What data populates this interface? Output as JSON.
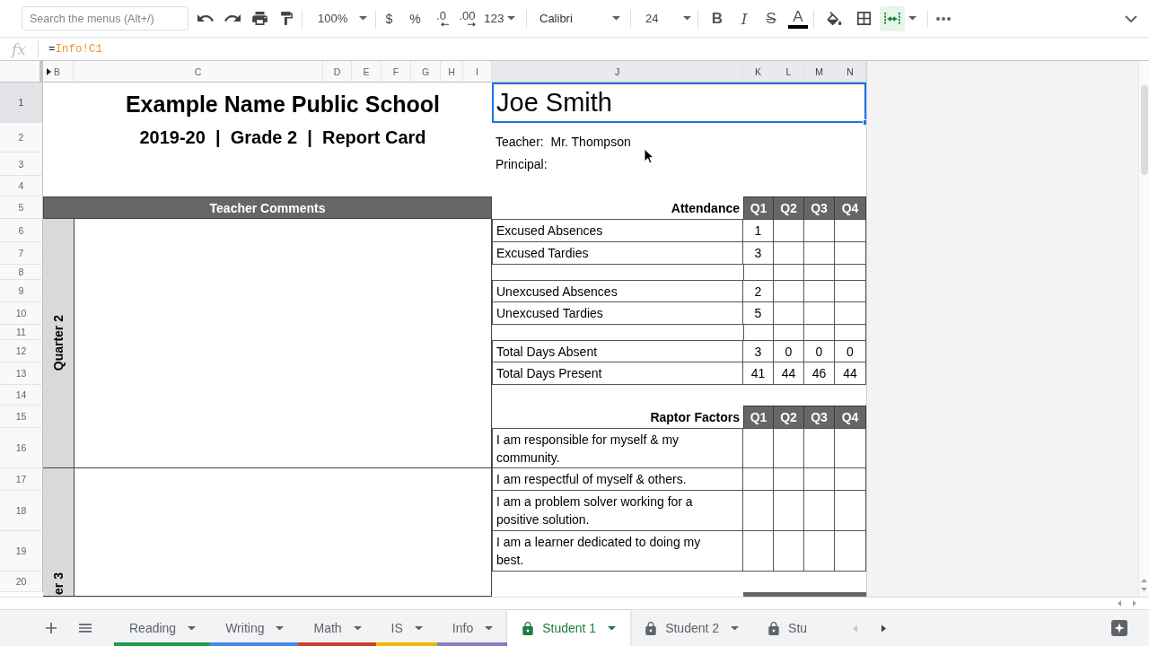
{
  "toolbar": {
    "search": {
      "placeholder": "Search the menus (Alt+/)"
    },
    "zoom": "100%",
    "format_buttons": [
      {
        "kind": "currency",
        "label": "$"
      },
      {
        "kind": "percent",
        "label": "%"
      },
      {
        "kind": "decrease_decimals",
        "label": ".0"
      },
      {
        "kind": "increase_decimals",
        "label": ".00"
      }
    ],
    "number_format": "123",
    "font": "Calibri",
    "font_size": "24",
    "style_buttons": [
      {
        "kind": "bold",
        "label": "B"
      },
      {
        "kind": "italic",
        "label": "I"
      },
      {
        "kind": "strikethrough",
        "label": "S"
      },
      {
        "kind": "text_color",
        "label": "A"
      }
    ],
    "merge_active": true
  },
  "formula_bar": {
    "fx": "fx",
    "prefix": "=",
    "reference": "Info!C1"
  },
  "columns": [
    {
      "label": "B",
      "selected": false,
      "hidden_left": true
    },
    {
      "label": "C",
      "selected": false,
      "hidden_left": false
    },
    {
      "label": "D",
      "selected": false,
      "hidden_left": false
    },
    {
      "label": "E",
      "selected": false,
      "hidden_left": false
    },
    {
      "label": "F",
      "selected": false,
      "hidden_left": false
    },
    {
      "label": "G",
      "selected": false,
      "hidden_left": false
    },
    {
      "label": "H",
      "selected": false,
      "hidden_left": false
    },
    {
      "label": "I",
      "selected": false,
      "hidden_left": false
    },
    {
      "label": "J",
      "selected": true,
      "hidden_left": false
    },
    {
      "label": "K",
      "selected": true,
      "hidden_left": false
    },
    {
      "label": "L",
      "selected": true,
      "hidden_left": false
    },
    {
      "label": "M",
      "selected": true,
      "hidden_left": false
    },
    {
      "label": "N",
      "selected": true,
      "hidden_left": false
    }
  ],
  "row_headers": [
    {
      "label": "1",
      "selected": true
    },
    {
      "label": "2",
      "selected": false
    },
    {
      "label": "3",
      "selected": false
    },
    {
      "label": "4",
      "selected": false
    },
    {
      "label": "5",
      "selected": false
    },
    {
      "label": "6",
      "selected": false
    },
    {
      "label": "7",
      "selected": false
    },
    {
      "label": "8",
      "selected": false
    },
    {
      "label": "9",
      "selected": false
    },
    {
      "label": "10",
      "selected": false
    },
    {
      "label": "11",
      "selected": false
    },
    {
      "label": "12",
      "selected": false
    },
    {
      "label": "13",
      "selected": false
    },
    {
      "label": "14",
      "selected": false
    },
    {
      "label": "15",
      "selected": false
    },
    {
      "label": "16",
      "selected": false
    },
    {
      "label": "17",
      "selected": false
    },
    {
      "label": "18",
      "selected": false
    },
    {
      "label": "19",
      "selected": false
    },
    {
      "label": "20",
      "selected": false
    }
  ],
  "title": "Example Name Public School",
  "subtitle": "2019-20  |  Grade 2  |  Report Card",
  "comments": {
    "header": "Teacher Comments",
    "sections": [
      {
        "label": "Quarter 2"
      },
      {
        "label": "er 3"
      }
    ]
  },
  "student": {
    "name": "Joe Smith",
    "selected": true,
    "teacher": "Teacher:  Mr. Thompson",
    "principal": "Principal:"
  },
  "attendance": {
    "title": "Attendance",
    "quarters": [
      "Q1",
      "Q2",
      "Q3",
      "Q4"
    ],
    "groups": [
      {
        "rows": [
          {
            "label": "Excused Absences",
            "values": [
              "1"
            ]
          },
          {
            "label": "Excused Tardies",
            "values": [
              "3"
            ]
          }
        ]
      },
      {
        "rows": [
          {
            "label": "Unexcused Absences",
            "values": [
              "2"
            ]
          },
          {
            "label": "Unexcused Tardies",
            "values": [
              "5"
            ]
          }
        ]
      },
      {
        "rows": [
          {
            "label": "Total Days Absent",
            "values": [
              "3",
              "0",
              "0",
              "0"
            ]
          },
          {
            "label": "Total Days Present",
            "values": [
              "41",
              "44",
              "46",
              "44"
            ]
          }
        ]
      }
    ]
  },
  "raptor_factors": {
    "title": "Raptor Factors",
    "quarters": [
      "Q1",
      "Q2",
      "Q3",
      "Q4"
    ],
    "rows": [
      {
        "label": "I am responsible for myself & my community."
      },
      {
        "label": "I am respectful of myself & others."
      },
      {
        "label": "I am a problem solver working for a positive solution."
      },
      {
        "label": "I am a learner dedicated to doing my best."
      }
    ]
  },
  "tabs": [
    {
      "label": "Reading",
      "selected": false,
      "locked": false,
      "dropdown": true,
      "color": "#1e9e4a"
    },
    {
      "label": "Writing",
      "selected": false,
      "locked": false,
      "dropdown": true,
      "color": "#4a86e8"
    },
    {
      "label": "Math",
      "selected": false,
      "locked": false,
      "dropdown": true,
      "color": "#d23f31"
    },
    {
      "label": "IS",
      "selected": false,
      "locked": false,
      "dropdown": true,
      "color": "#f4b400"
    },
    {
      "label": "Info",
      "selected": false,
      "locked": false,
      "dropdown": true,
      "color": "#8e7cc3"
    },
    {
      "label": "Student 1",
      "selected": true,
      "locked": true,
      "dropdown": true
    },
    {
      "label": "Student 2",
      "selected": false,
      "locked": true,
      "dropdown": true
    },
    {
      "label": "Stu",
      "selected": false,
      "locked": true,
      "dropdown": false
    }
  ]
}
